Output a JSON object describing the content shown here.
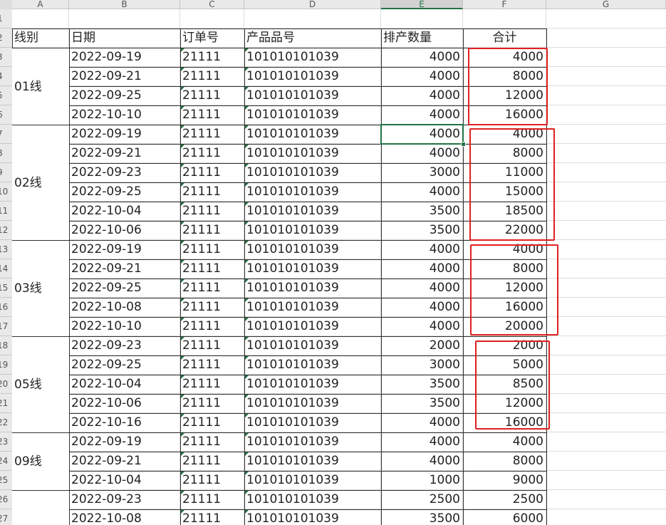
{
  "columns": [
    "A",
    "B",
    "C",
    "D",
    "E",
    "F",
    "G"
  ],
  "row_numbers": [
    "1",
    "2",
    "3",
    "4",
    "5",
    "6",
    "7",
    "8",
    "9",
    "10",
    "11",
    "12",
    "13",
    "14",
    "15",
    "16",
    "17",
    "18",
    "19",
    "20",
    "21",
    "22",
    "23",
    "24",
    "25",
    "26",
    "27"
  ],
  "headers": {
    "line": "线别",
    "date": "日期",
    "order": "订单号",
    "product": "产品品号",
    "qty": "排产数量",
    "total": "合计"
  },
  "groups": [
    {
      "line": "01线",
      "rows": [
        {
          "date": "2022-09-19",
          "order": "21111",
          "product": "101010101039",
          "qty": "4000",
          "total": "4000"
        },
        {
          "date": "2022-09-21",
          "order": "21111",
          "product": "101010101039",
          "qty": "4000",
          "total": "8000"
        },
        {
          "date": "2022-09-25",
          "order": "21111",
          "product": "101010101039",
          "qty": "4000",
          "total": "12000"
        },
        {
          "date": "2022-10-10",
          "order": "21111",
          "product": "101010101039",
          "qty": "4000",
          "total": "16000"
        }
      ]
    },
    {
      "line": "02线",
      "rows": [
        {
          "date": "2022-09-19",
          "order": "21111",
          "product": "101010101039",
          "qty": "4000",
          "total": "4000"
        },
        {
          "date": "2022-09-21",
          "order": "21111",
          "product": "101010101039",
          "qty": "4000",
          "total": "8000"
        },
        {
          "date": "2022-09-23",
          "order": "21111",
          "product": "101010101039",
          "qty": "3000",
          "total": "11000"
        },
        {
          "date": "2022-09-25",
          "order": "21111",
          "product": "101010101039",
          "qty": "4000",
          "total": "15000"
        },
        {
          "date": "2022-10-04",
          "order": "21111",
          "product": "101010101039",
          "qty": "3500",
          "total": "18500"
        },
        {
          "date": "2022-10-06",
          "order": "21111",
          "product": "101010101039",
          "qty": "3500",
          "total": "22000"
        }
      ]
    },
    {
      "line": "03线",
      "rows": [
        {
          "date": "2022-09-19",
          "order": "21111",
          "product": "101010101039",
          "qty": "4000",
          "total": "4000"
        },
        {
          "date": "2022-09-21",
          "order": "21111",
          "product": "101010101039",
          "qty": "4000",
          "total": "8000"
        },
        {
          "date": "2022-09-25",
          "order": "21111",
          "product": "101010101039",
          "qty": "4000",
          "total": "12000"
        },
        {
          "date": "2022-10-08",
          "order": "21111",
          "product": "101010101039",
          "qty": "4000",
          "total": "16000"
        },
        {
          "date": "2022-10-10",
          "order": "21111",
          "product": "101010101039",
          "qty": "4000",
          "total": "20000"
        }
      ]
    },
    {
      "line": "05线",
      "rows": [
        {
          "date": "2022-09-23",
          "order": "21111",
          "product": "101010101039",
          "qty": "2000",
          "total": "2000"
        },
        {
          "date": "2022-09-25",
          "order": "21111",
          "product": "101010101039",
          "qty": "3000",
          "total": "5000"
        },
        {
          "date": "2022-10-04",
          "order": "21111",
          "product": "101010101039",
          "qty": "3500",
          "total": "8500"
        },
        {
          "date": "2022-10-06",
          "order": "21111",
          "product": "101010101039",
          "qty": "3500",
          "total": "12000"
        },
        {
          "date": "2022-10-16",
          "order": "21111",
          "product": "101010101039",
          "qty": "4000",
          "total": "16000"
        }
      ]
    },
    {
      "line": "09线",
      "rows": [
        {
          "date": "2022-09-19",
          "order": "21111",
          "product": "101010101039",
          "qty": "4000",
          "total": "4000"
        },
        {
          "date": "2022-09-21",
          "order": "21111",
          "product": "101010101039",
          "qty": "4000",
          "total": "8000"
        },
        {
          "date": "2022-10-04",
          "order": "21111",
          "product": "101010101039",
          "qty": "1000",
          "total": "9000"
        }
      ]
    },
    {
      "line": "",
      "rows": [
        {
          "date": "2022-09-23",
          "order": "21111",
          "product": "101010101039",
          "qty": "2500",
          "total": "2500"
        },
        {
          "date": "2022-10-08",
          "order": "21111",
          "product": "101010101039",
          "qty": "3500",
          "total": "6000"
        }
      ]
    }
  ],
  "selected_cell": "E7",
  "colors": {
    "grid": "#dcdcdc",
    "border": "#333333",
    "highlight": "#e02020",
    "selection": "#217346"
  }
}
